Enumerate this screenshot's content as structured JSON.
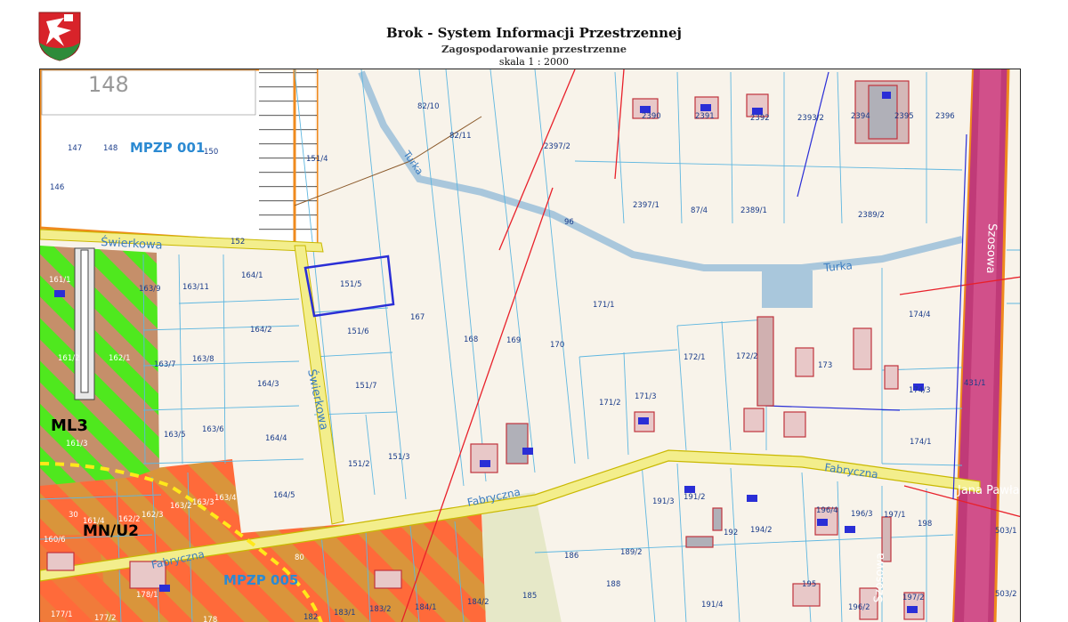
{
  "header": {
    "title": "Brok - System Informacji Przestrzennej",
    "subtitle": "Zagospodarowanie przestrzenne",
    "scale": "skala 1 : 2000",
    "logo_icon": "coat-of-arms-icon"
  },
  "colors": {
    "background": "#f8f3ea",
    "parcel_line": "#5fb7e0",
    "road_fill": "#f3ee8c",
    "road_edge": "#c9b800",
    "power_line": "#e8202a",
    "water": "#a9c7dc",
    "selection": "#2a2ed6",
    "mpzp_boundary": "#ef8a1e",
    "mpzp_white": "#ffffff",
    "green_zone": "#4fe81e",
    "brown_zone": "#c58f6a",
    "orange_zone": "#ff6a3a",
    "ochre_zone": "#d9953b",
    "magenta_road": "#c03a78"
  },
  "map": {
    "zones": {
      "mpzp_001": "MPZP 001",
      "mpzp_005": "MPZP 005",
      "ml3": "ML3",
      "mnu2": "MN/U2"
    },
    "streets": {
      "swierkowa_h": "Świerkowa",
      "swierkowa_v": "Świerkowa",
      "turka_1": "Turka",
      "turka_2": "Turka",
      "fabryczna_1": "Fabryczna",
      "fabryczna_2": "Fabryczna",
      "fabryczna_3": "Fabryczna",
      "szosowa_1": "Szosowa",
      "szosowa_2": "Szosowa",
      "jana_pawla": "Jana Pawła",
      "old_148": "148"
    },
    "parcels": [
      "147",
      "148",
      "150",
      "146",
      "151/4",
      "152",
      "82/10",
      "82/11",
      "2397/2",
      "96",
      "2397/1",
      "87/4",
      "2389/1",
      "2389/2",
      "2390",
      "2391",
      "2392",
      "2393/2",
      "2394",
      "2395",
      "2396",
      "151/5",
      "151/6",
      "151/7",
      "151/2",
      "151/3",
      "163/9",
      "163/11",
      "164/1",
      "164/2",
      "164/3",
      "164/4",
      "164/5",
      "163/7",
      "163/8",
      "163/5",
      "163/6",
      "167",
      "168",
      "169",
      "170",
      "171/1",
      "171/2",
      "171/3",
      "172/1",
      "172/2",
      "173",
      "174/4",
      "174/3",
      "174/1",
      "161/3",
      "161/2",
      "162/1",
      "161/1",
      "163/2",
      "163/3",
      "163/4",
      "162/3",
      "162/2",
      "161/4",
      "160/6",
      "178/1",
      "177/1",
      "177/2",
      "184/1",
      "184/2",
      "183/1",
      "183/2",
      "182",
      "178",
      "185",
      "186",
      "188",
      "189/2",
      "191/3",
      "191/2",
      "191/4",
      "192",
      "194/2",
      "195",
      "196/4",
      "196/3",
      "197/1",
      "196/2",
      "197/2",
      "198",
      "431/1",
      "503/1",
      "503/2",
      "30",
      "80"
    ]
  }
}
